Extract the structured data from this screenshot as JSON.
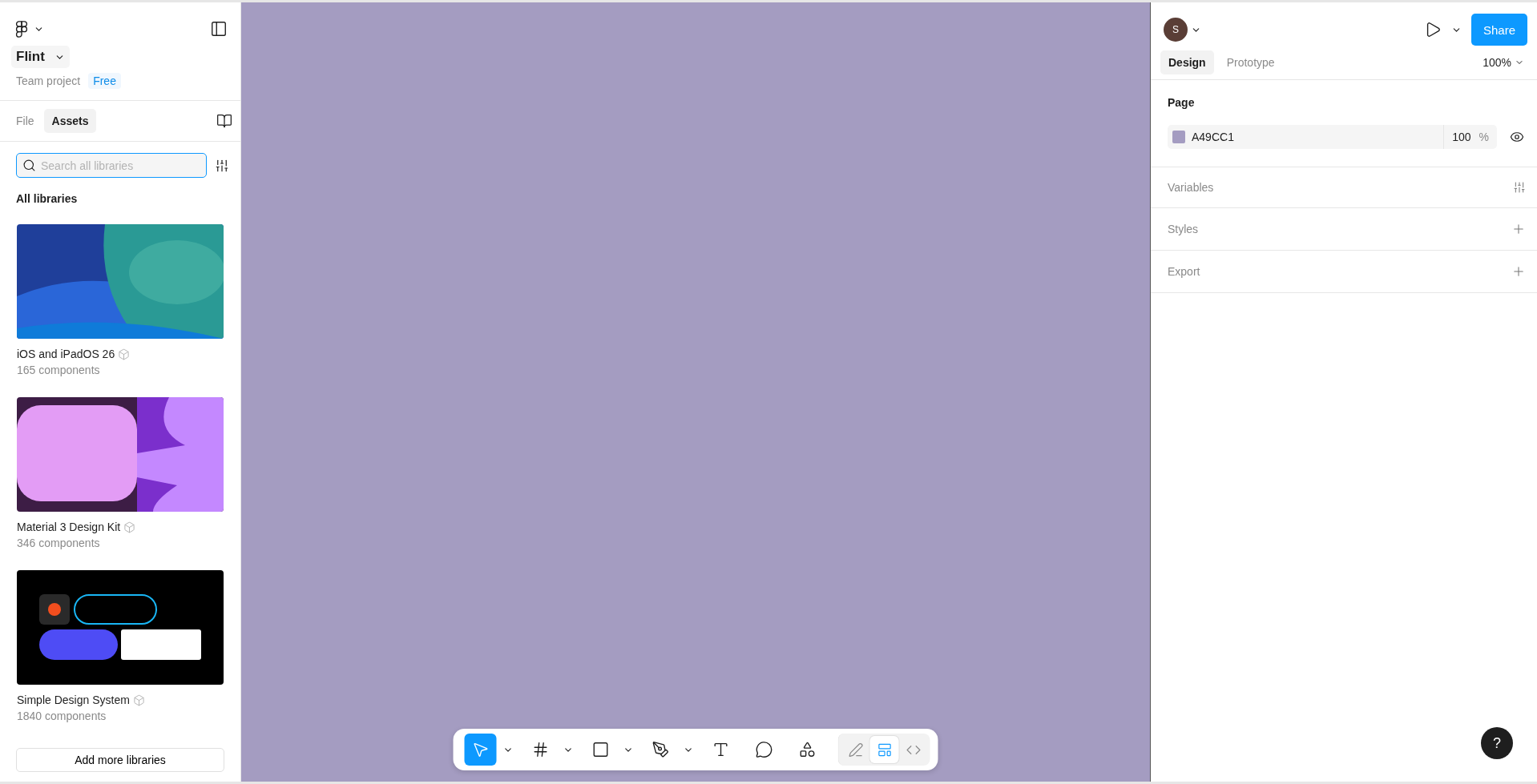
{
  "left_panel": {
    "project": {
      "name": "Flint",
      "team": "Team project",
      "plan": "Free"
    },
    "tabs": [
      {
        "label": "File",
        "selected": false
      },
      {
        "label": "Assets",
        "selected": true
      }
    ],
    "search": {
      "placeholder": "Search all libraries"
    },
    "section_title": "All libraries",
    "libraries": [
      {
        "name": "iOS and iPadOS 26",
        "count": "165 components",
        "kind": "picture"
      },
      {
        "name": "Material 3 Design Kit",
        "count": "346 components",
        "kind": "picture"
      },
      {
        "name": "Simple Design System",
        "count": "1840 components",
        "kind": "picture"
      }
    ],
    "add_button": "Add more libraries"
  },
  "toolbar": {
    "tools": [
      {
        "kind": "move",
        "selected": true,
        "dropdown": true
      },
      {
        "kind": "frame",
        "selected": false,
        "dropdown": true
      },
      {
        "kind": "shape",
        "selected": false,
        "dropdown": true
      },
      {
        "kind": "pen",
        "selected": false,
        "dropdown": true
      },
      {
        "kind": "text",
        "selected": false,
        "dropdown": false
      },
      {
        "kind": "comment",
        "selected": false,
        "dropdown": false
      },
      {
        "kind": "assets",
        "selected": false,
        "dropdown": false
      }
    ],
    "modes": [
      {
        "kind": "draw",
        "selected": false
      },
      {
        "kind": "design",
        "selected": true
      },
      {
        "kind": "dev",
        "selected": false
      }
    ]
  },
  "right_panel": {
    "avatar": "S",
    "share": "Share",
    "tabs": [
      {
        "label": "Design",
        "selected": true
      },
      {
        "label": "Prototype",
        "selected": false
      }
    ],
    "zoom": "100%",
    "page": {
      "title": "Page",
      "hex": "A49CC1",
      "opacity": "100",
      "unit": "%",
      "color": "#a49cc1"
    },
    "sections": [
      {
        "title": "Variables",
        "kind": "variables"
      },
      {
        "title": "Styles",
        "kind": "add"
      },
      {
        "title": "Export",
        "kind": "add"
      }
    ]
  },
  "help": "?"
}
